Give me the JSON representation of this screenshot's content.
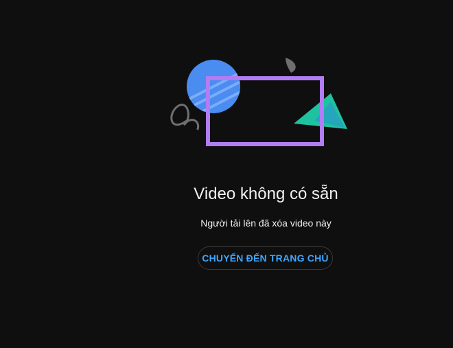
{
  "main": {
    "title": "Video không có sẵn",
    "subtitle": "Người tải lên đã xóa video này",
    "home_button_label": "CHUYỂN ĐẾN TRANG CHỦ"
  },
  "colors": {
    "background": "#0f0f0f",
    "text": "#f1f1f1",
    "accent_link": "#3ea6ff",
    "frame_purple": "#b27cf3",
    "circle_blue": "#4a8cf0",
    "triangle_teal": "#1ec2a0"
  },
  "icons": {
    "illustration": "unavailable-video-illustration"
  }
}
